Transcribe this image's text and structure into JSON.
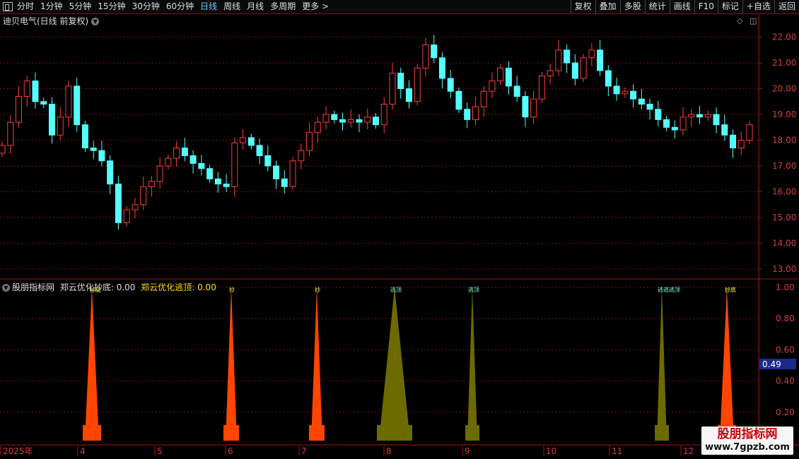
{
  "toolbar": {
    "tabs": [
      "分时",
      "1分钟",
      "5分钟",
      "15分钟",
      "30分钟",
      "60分钟",
      "日线",
      "周线",
      "月线",
      "多周期",
      "更多 >"
    ],
    "active_tab": "日线",
    "right_buttons": [
      "复权",
      "叠加",
      "多股",
      "统计",
      "画线",
      "F10",
      "标记",
      "+自选",
      "返回"
    ]
  },
  "main_title": "迪贝电气(日线 前复权)",
  "indicator": {
    "name": "股朋指标网",
    "label1": "郑云优化抄底: 0.00",
    "label2": "郑云优化逃顶: 0.00",
    "current_value": "0.49"
  },
  "colors": {
    "up": "#ff3c3c",
    "down": "#54ffff",
    "buy": "#ff4500",
    "sell": "#6b6b00",
    "grid": "#7a1010",
    "axis": "#aa1111"
  },
  "watermark": {
    "line1": "股朋指标网",
    "line2": "www.7gpzb.com"
  },
  "chart_data": [
    {
      "type": "candlestick",
      "title": "迪贝电气(日线 前复权)",
      "ylim": [
        12.7,
        22.4
      ],
      "y_ticks": [
        "13.00",
        "14.00",
        "15.00",
        "16.00",
        "17.00",
        "18.00",
        "19.00",
        "20.00",
        "21.00",
        "22.00"
      ],
      "x_ticks": [
        "2025年",
        "4",
        "5",
        "6",
        "7",
        "8",
        "9",
        "10",
        "11",
        "12"
      ],
      "series": [
        {
          "values": [
            17.8,
            18.7,
            19.7,
            20.3,
            19.5,
            19.4,
            18.2,
            18.9,
            20.1,
            18.6,
            17.7,
            17.6,
            17.2,
            16.3,
            14.8,
            15.3,
            15.5,
            16.2,
            16.4,
            17.0,
            17.3,
            17.7,
            17.4,
            17.1,
            16.9,
            16.5,
            16.3,
            16.2,
            17.9,
            18.1,
            17.8,
            17.4,
            17.0,
            16.5,
            16.2,
            17.2,
            17.6,
            18.3,
            18.7,
            19.0,
            18.8,
            18.7,
            18.8,
            18.7,
            18.9,
            18.6,
            19.4,
            20.6,
            20.0,
            19.5,
            20.8,
            21.7,
            21.2,
            20.4,
            19.9,
            19.2,
            18.8,
            19.3,
            19.9,
            20.3,
            20.8,
            20.1,
            19.7,
            18.9,
            19.6,
            20.5,
            20.7,
            21.5,
            21.0,
            20.4,
            21.2,
            21.5,
            20.7,
            20.1,
            19.8,
            19.9,
            19.6,
            19.4,
            19.2,
            18.8,
            18.5,
            18.4,
            18.9,
            19.0,
            18.9,
            19.0,
            18.6,
            18.2,
            17.7,
            18.0,
            18.6
          ],
          "name": ""
        }
      ]
    },
    {
      "type": "bar",
      "title": "股朋指标网",
      "ylim": [
        0,
        1.05
      ],
      "y_ticks": [
        "0.20",
        "0.40",
        "0.60",
        "0.80",
        "1.00"
      ],
      "series": [
        {
          "name": "郑云优化抄底",
          "values": [
            1,
            1
          ]
        },
        {
          "name": "郑云优化逃顶",
          "values": [
            1,
            1,
            1
          ]
        }
      ],
      "buy_signals": [
        {
          "label": "抄底",
          "value": 1
        },
        {
          "label": "抄",
          "value": 1
        },
        {
          "label": "抄",
          "value": 1
        },
        {
          "label": "抄底",
          "value": 1
        }
      ],
      "sell_signals": [
        {
          "label": "逃顶",
          "value": 1
        },
        {
          "label": "逃顶",
          "value": 1
        },
        {
          "label": "逃逃逃顶",
          "value": 1
        }
      ]
    }
  ]
}
